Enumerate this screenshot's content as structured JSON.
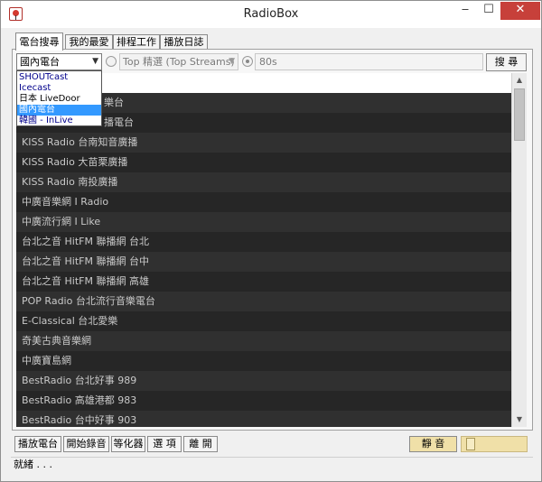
{
  "window": {
    "title": "RadioBox",
    "minimize_glyph": "‒",
    "maximize_glyph": "☐",
    "close_glyph": "✕",
    "app_icon": "radio-app-icon"
  },
  "tabs": [
    {
      "label": "電台搜尋",
      "active": true
    },
    {
      "label": "我的最愛",
      "active": false
    },
    {
      "label": "排程工作",
      "active": false
    },
    {
      "label": "播放日誌",
      "active": false
    }
  ],
  "search": {
    "source_value": "國內電台",
    "category_value": "Top 精選 (Top Streams)",
    "keyword_value": "80s",
    "search_button": "搜 尋",
    "dropdown_arrow": "▼"
  },
  "source_options": [
    {
      "label": "SHOUTcast",
      "selected": false
    },
    {
      "label": "Icecast",
      "selected": false
    },
    {
      "label": "日本 LiveDoor",
      "selected": false
    },
    {
      "label": "國內電台",
      "selected": true
    },
    {
      "label": "韓國 - InLive",
      "selected": false
    }
  ],
  "stations": [
    {
      "name": "",
      "selected": true
    },
    {
      "name": "KISS Radio 台南知音廣播",
      "selected": false,
      "partial": "樂台"
    },
    {
      "name": "KISS Radio 台南知音廣播",
      "selected": false,
      "partial": "播電台"
    },
    {
      "name": "KISS Radio 台南知音廣播",
      "selected": false
    },
    {
      "name": "KISS Radio 大苗栗廣播",
      "selected": false
    },
    {
      "name": "KISS Radio 南投廣播",
      "selected": false
    },
    {
      "name": "中廣音樂網 I Radio",
      "selected": false
    },
    {
      "name": "中廣流行網 I Like",
      "selected": false
    },
    {
      "name": "台北之音 HitFM 聯播網 台北",
      "selected": false
    },
    {
      "name": "台北之音 HitFM 聯播網 台中",
      "selected": false
    },
    {
      "name": "台北之音 HitFM 聯播網 高雄",
      "selected": false
    },
    {
      "name": "POP Radio 台北流行音樂電台",
      "selected": false
    },
    {
      "name": "E-Classical 台北愛樂",
      "selected": false
    },
    {
      "name": "奇美古典音樂網",
      "selected": false
    },
    {
      "name": "中廣寶島網",
      "selected": false
    },
    {
      "name": "BestRadio 台北好事 989",
      "selected": false
    },
    {
      "name": "BestRadio 高雄港都 983",
      "selected": false
    },
    {
      "name": "BestRadio 台中好事 903",
      "selected": false
    }
  ],
  "scrollbar": {
    "up_glyph": "▲",
    "down_glyph": "▼"
  },
  "controls": {
    "play": "播放電台",
    "record": "開始錄音",
    "equalizer": "等化器",
    "options": "選 項",
    "exit": "離 開",
    "mute": "靜 音",
    "volume_level": 0.05
  },
  "status": {
    "text": "就緒 . . ."
  }
}
